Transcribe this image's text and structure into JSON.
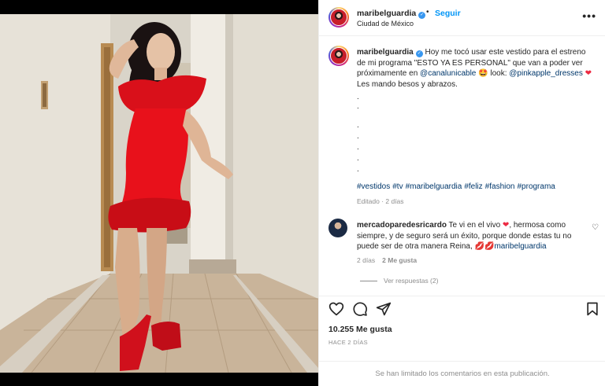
{
  "post": {
    "username": "maribelguardia",
    "follow_label": "Seguir",
    "separator": "•",
    "location": "Ciudad de México",
    "more_label": "•••",
    "verified_mark": "✓"
  },
  "caption": {
    "username": "maribelguardia",
    "text_1": "Hoy me tocó usar este vestido para el estreno de mi programa \"ESTO YA ES PERSONAL\" que van a poder ver próximamente en ",
    "mention_1": "@canalunicable",
    "text_2": " 🤩 look: ",
    "mention_2": "@pinkapple_dresses",
    "heart": "❤",
    "text_3": " Les mando besos y abrazos.",
    "dot": ".",
    "hashtags": [
      "#vestidos",
      "#tv",
      "#maribelguardia",
      "#feliz",
      "#fashion",
      "#programa"
    ],
    "edited": "Editado · 2 días"
  },
  "comment": {
    "username": "mercadoparedesricardo",
    "text_1": " Te vi en el vivo ",
    "heart": "❤",
    "text_2": ", hermosa como siempre, y de seguro será un éxito, porque donde estas tu no puede ser de otra manera Reina, ",
    "lips": "💋💋",
    "mention": "maribelguardia",
    "time": "2 días",
    "likes": "2 Me gusta",
    "replies": "Ver respuestas (2)",
    "like_icon": "♡"
  },
  "actions": {
    "likes": "10.255 Me gusta",
    "ago": "HACE 2 DÍAS"
  },
  "footer": {
    "limited": "Se han limitado los comentarios en esta publicación."
  }
}
